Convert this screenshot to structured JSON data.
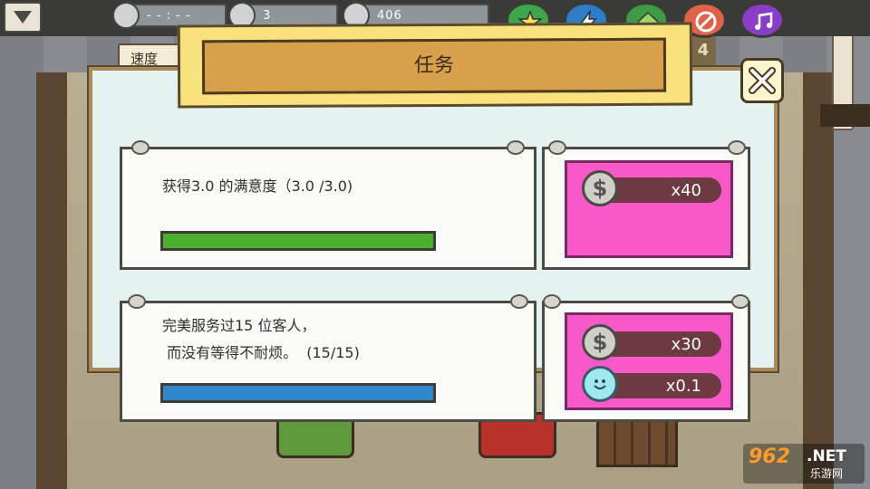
{
  "hud": {
    "timer": "- - : - -",
    "satisfaction": "3",
    "money": "406",
    "speed_label": "速度",
    "counter": "4",
    "category_buttons": [
      "star",
      "bolt",
      "plant",
      "no",
      "music"
    ]
  },
  "dialog": {
    "title": "任务",
    "tasks": [
      {
        "text": "获得3.0 的满意度（3.0 /3.0)",
        "progress": 1.0,
        "bar_color": "#4caf2e",
        "rewards": [
          {
            "icon": "coin-icon",
            "amount": "x40"
          }
        ]
      },
      {
        "text": "完美服务过15 位客人，\n 而没有等得不耐烦。  (15/15)",
        "progress": 1.0,
        "bar_color": "#2f86c8",
        "rewards": [
          {
            "icon": "coin-icon",
            "amount": "x30"
          },
          {
            "icon": "smiley-icon",
            "amount": "x0.1"
          }
        ]
      }
    ]
  },
  "watermark": {
    "number": "962",
    "domain": ".NET",
    "subtitle": "乐游网"
  },
  "colors": {
    "reward_panel": "#f75ac8",
    "dialog_bg": "#e4f2f1",
    "title_board": "#d9a04c"
  }
}
